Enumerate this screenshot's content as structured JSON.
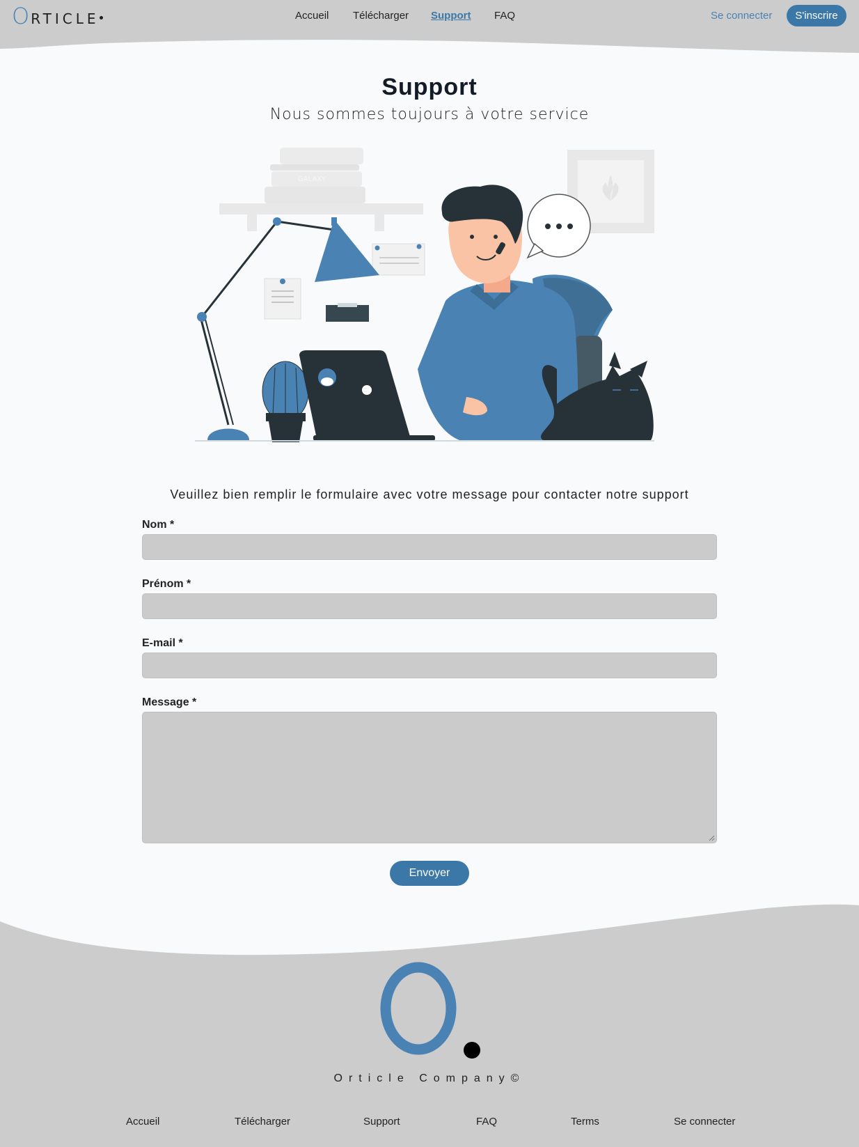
{
  "header": {
    "logo_letter": "O",
    "logo_rest": "RTICLE",
    "nav": [
      "Accueil",
      "Télécharger",
      "Support",
      "FAQ"
    ],
    "active_nav": "Support",
    "login": "Se connecter",
    "signup": "S'inscrire"
  },
  "page": {
    "title": "Support",
    "subtitle": "Nous sommes toujours à votre service",
    "intro": "Veuillez bien remplir le formulaire avec votre message pour contacter notre support"
  },
  "form": {
    "nom_label": "Nom *",
    "prenom_label": "Prénom *",
    "email_label": "E-mail *",
    "message_label": "Message *",
    "submit": "Envoyer"
  },
  "illustration": {
    "book_label": "GALAXY"
  },
  "footer": {
    "company": "Orticle Company©",
    "nav": [
      "Accueil",
      "Télécharger",
      "Support",
      "FAQ",
      "Terms",
      "Se connecter"
    ]
  },
  "colors": {
    "accent": "#3b78a8",
    "gray_band": "#cccccc",
    "input_bg": "#cbcbcb",
    "page_bg": "#f8fafb"
  }
}
